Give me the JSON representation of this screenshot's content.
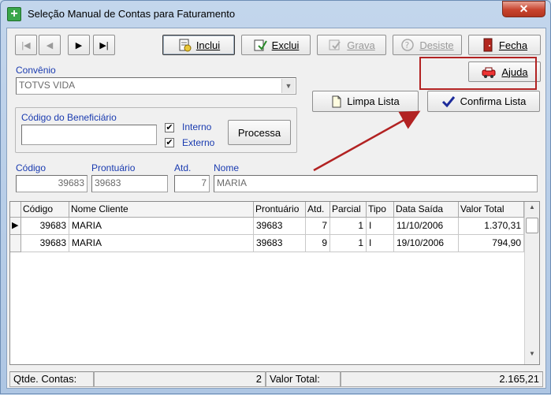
{
  "window": {
    "title": "Seleção Manual de Contas para Faturamento",
    "close_label": "✕"
  },
  "toolbar": {
    "nav_first": "|◀",
    "nav_prev": "◀",
    "nav_next": "▶",
    "nav_last": "▶|",
    "inclui": "Inclui",
    "exclui": "Exclui",
    "grava": "Grava",
    "desiste": "Desiste",
    "fecha": "Fecha",
    "ajuda": "Ajuda"
  },
  "convenio": {
    "label": "Convênio",
    "value": "TOTVS VIDA"
  },
  "beneficiario": {
    "label": "Código do  Beneficiário",
    "value": "",
    "interno_label": "Interno",
    "interno_checked": true,
    "externo_label": "Externo",
    "externo_checked": true,
    "processa": "Processa"
  },
  "actions": {
    "limpa_lista": "Limpa Lista",
    "confirma_lista": "Confirma Lista"
  },
  "record": {
    "codigo_label": "Código",
    "codigo": "39683",
    "prontuario_label": "Prontuário",
    "prontuario": "39683",
    "atd_label": "Atd.",
    "atd": "7",
    "nome_label": "Nome",
    "nome": "MARIA"
  },
  "grid": {
    "columns": [
      "Código",
      "Nome Cliente",
      "Prontuário",
      "Atd.",
      "Parcial",
      "Tipo",
      "Data Saída",
      "Valor Total"
    ],
    "rows": [
      [
        "39683",
        "MARIA",
        "39683",
        "7",
        "1",
        "I",
        "11/10/2006",
        "1.370,31"
      ],
      [
        "39683",
        "MARIA",
        "39683",
        "9",
        "1",
        "I",
        "19/10/2006",
        "794,90"
      ]
    ],
    "current_row_marker": "▶"
  },
  "status": {
    "qtde_label": "Qtde. Contas:",
    "qtde_value": "2",
    "valor_label": "Valor Total:",
    "valor_value": "2.165,21"
  },
  "colors": {
    "highlight": "#b22222",
    "label_blue": "#1a3bb0"
  },
  "icons": {
    "inclui": "add-document-icon",
    "exclui": "delete-icon",
    "grava": "save-icon",
    "desiste": "cancel-icon",
    "fecha": "door-exit-icon",
    "ajuda": "help-icon",
    "limpa": "new-page-icon",
    "confirma": "checkmark-icon"
  }
}
